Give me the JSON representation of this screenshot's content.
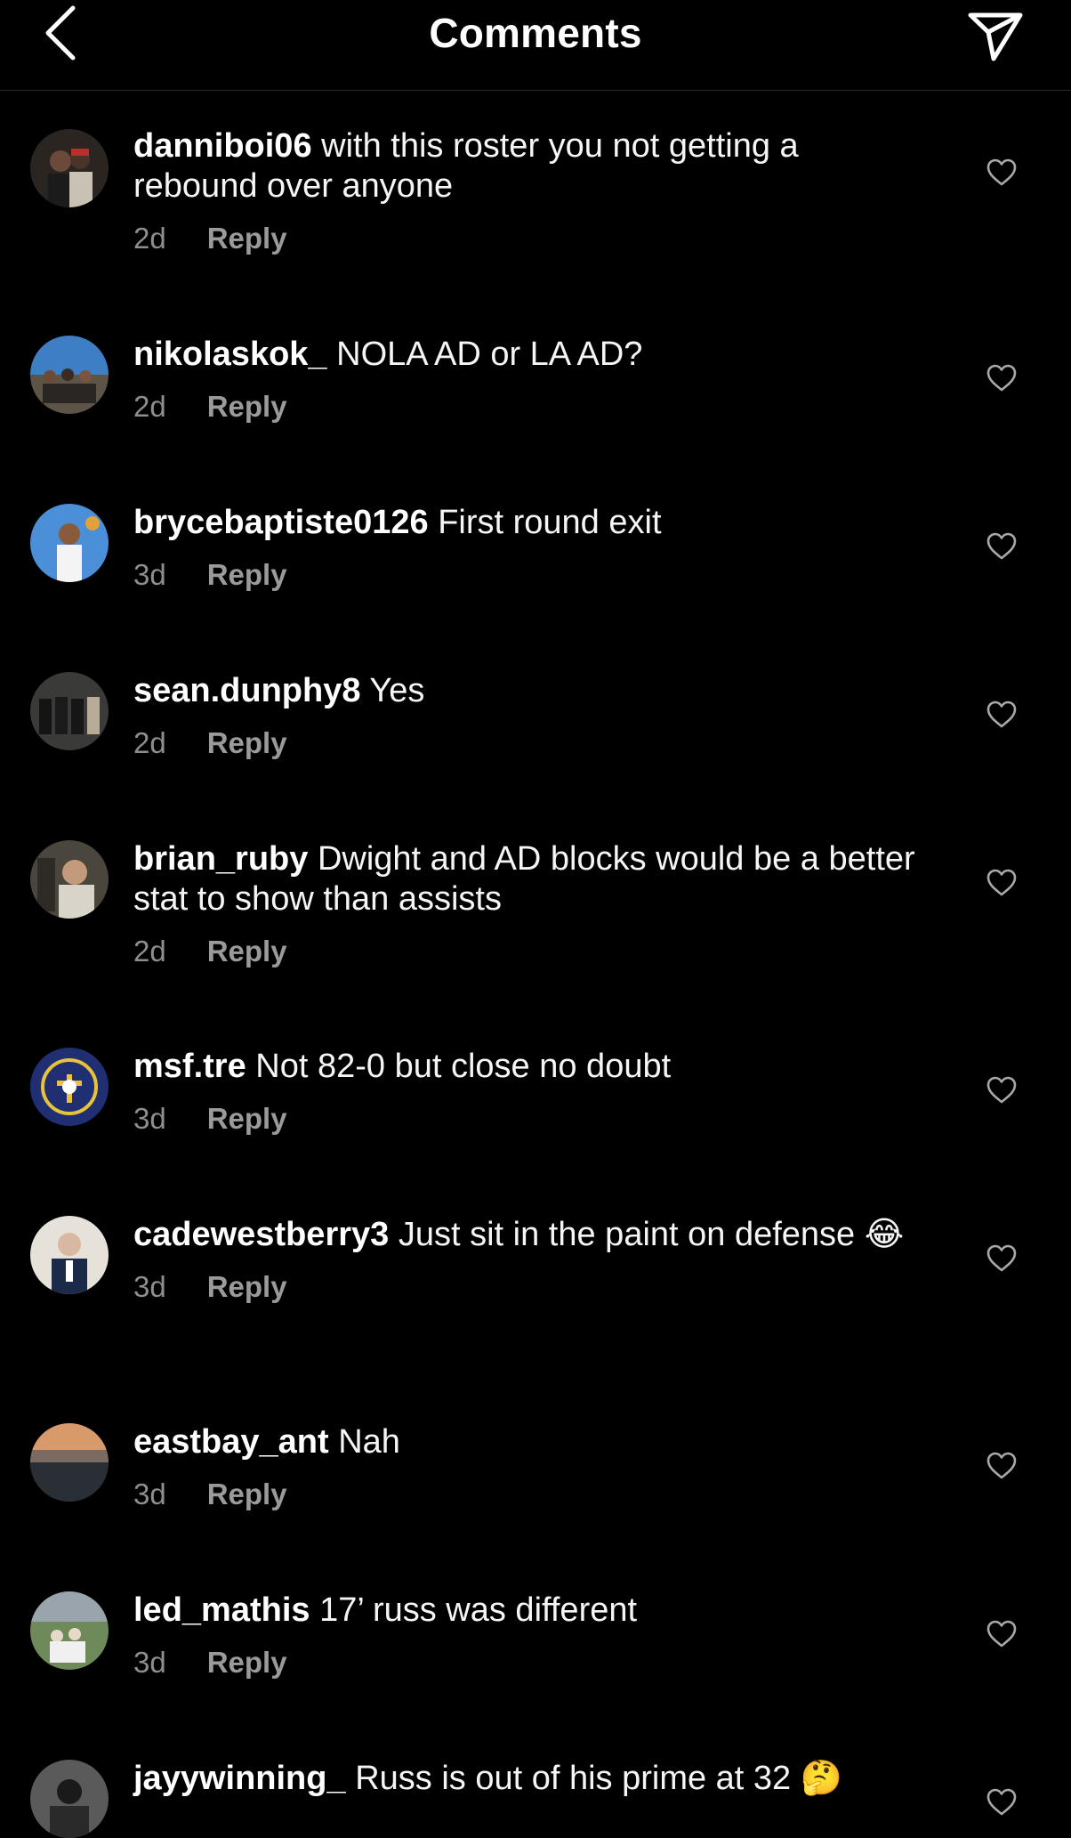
{
  "header": {
    "title": "Comments",
    "back_icon": "chevron-left-icon",
    "share_icon": "send-icon"
  },
  "comments": [
    {
      "username": "danniboi06",
      "text": "with this roster you not getting a rebound over anyone",
      "time": "2d",
      "reply": "Reply"
    },
    {
      "username": "nikolaskok_",
      "text": "NOLA AD or LA AD?",
      "time": "2d",
      "reply": "Reply"
    },
    {
      "username": "brycebaptiste0126",
      "text": "First round exit",
      "time": "3d",
      "reply": "Reply"
    },
    {
      "username": "sean.dunphy8",
      "text": "Yes",
      "time": "2d",
      "reply": "Reply"
    },
    {
      "username": "brian_ruby",
      "text": "Dwight and AD blocks would be a better stat to show than assists",
      "time": "2d",
      "reply": "Reply"
    },
    {
      "username": "msf.tre",
      "text": "Not 82-0 but close no doubt",
      "time": "3d",
      "reply": "Reply"
    },
    {
      "username": "cadewestberry3",
      "text": "Just sit in the paint on defense 😂",
      "time": "3d",
      "reply": "Reply"
    },
    {
      "username": "eastbay_ant",
      "text": "Nah",
      "time": "3d",
      "reply": "Reply"
    },
    {
      "username": "led_mathis",
      "text": "17’ russ was different",
      "time": "3d",
      "reply": "Reply"
    },
    {
      "username": "jayywinning_",
      "text": "Russ is out of his prime at 32 🤔",
      "time": "",
      "reply": ""
    }
  ]
}
